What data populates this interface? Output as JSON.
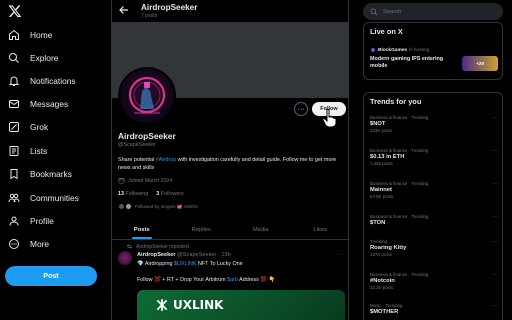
{
  "nav": {
    "items": [
      {
        "label": "Home",
        "icon": "home-icon"
      },
      {
        "label": "Explore",
        "icon": "search-icon"
      },
      {
        "label": "Notifications",
        "icon": "bell-icon"
      },
      {
        "label": "Messages",
        "icon": "envelope-icon"
      },
      {
        "label": "Grok",
        "icon": "grok-icon"
      },
      {
        "label": "Lists",
        "icon": "list-icon"
      },
      {
        "label": "Bookmarks",
        "icon": "bookmark-icon"
      },
      {
        "label": "Communities",
        "icon": "people-icon"
      },
      {
        "label": "Profile",
        "icon": "person-icon"
      },
      {
        "label": "More",
        "icon": "more-circle-icon"
      }
    ],
    "post_label": "Post"
  },
  "header": {
    "name": "AirdropSeeker",
    "posts": "7 posts"
  },
  "profile": {
    "name": "AirdropSeeker",
    "handle": "@ScapeSeeker",
    "follow_label": "Follow",
    "more": "···",
    "bio_1": "Share potential ",
    "bio_link": "#Airdrop",
    "bio_2": " with investigation carefully and detail guide. Follow me to get more news and skills",
    "joined": "Joined March 2024",
    "following_count": "13",
    "following_label": "Following",
    "followers_count": "3",
    "followers_label": "Followers",
    "followed_by": "Followed by longien 🐙 SMON"
  },
  "tabs": [
    "Posts",
    "Replies",
    "Media",
    "Likes"
  ],
  "tweet": {
    "repost_label": "AirdropSeeker reposted",
    "author": "AirdropSeeker",
    "handle_time": "@ScapeSeeker · 19h",
    "more": "···",
    "line1_pre": "💎 Airdropping ",
    "line1_link": "$UXLINK",
    "line1_post": " NFT To Lucky One",
    "line2_pre": "Follow 💯 + RT + Drop Your Arbitrum ",
    "line2_link": "$arb",
    "line2_post": " Address 💯 👇",
    "image_text": "UXLINK"
  },
  "search": {
    "placeholder": "Search"
  },
  "live": {
    "title": "Live on X",
    "host_name": "BlockGames",
    "host_suffix": " is hosting",
    "desc": "Modern gaming IPS entering mobile",
    "listeners": "+29"
  },
  "trends": {
    "title": "Trends for you",
    "items": [
      {
        "category": "Business & finance · Trending",
        "name": "$NOT",
        "count": "223K posts"
      },
      {
        "category": "Business & finance · Trending",
        "name": "$0.13 in ETH",
        "count": "1,456 posts"
      },
      {
        "category": "Business & finance · Trending",
        "name": "Mainnet",
        "count": "67.5K posts"
      },
      {
        "category": "Business & finance · Trending",
        "name": "$TON",
        "count": ""
      },
      {
        "category": "Trending",
        "name": "Roaring Kitty",
        "count": "127K posts"
      },
      {
        "category": "Business & finance · Trending",
        "name": "#Notcoin",
        "count": "22.2K posts"
      },
      {
        "category": "Music · Trending",
        "name": "$MOTHER",
        "count": ""
      }
    ]
  },
  "colors": {
    "accent": "#1d9bf0",
    "background": "#000000",
    "border": "#2f3336",
    "muted": "#71767b"
  }
}
